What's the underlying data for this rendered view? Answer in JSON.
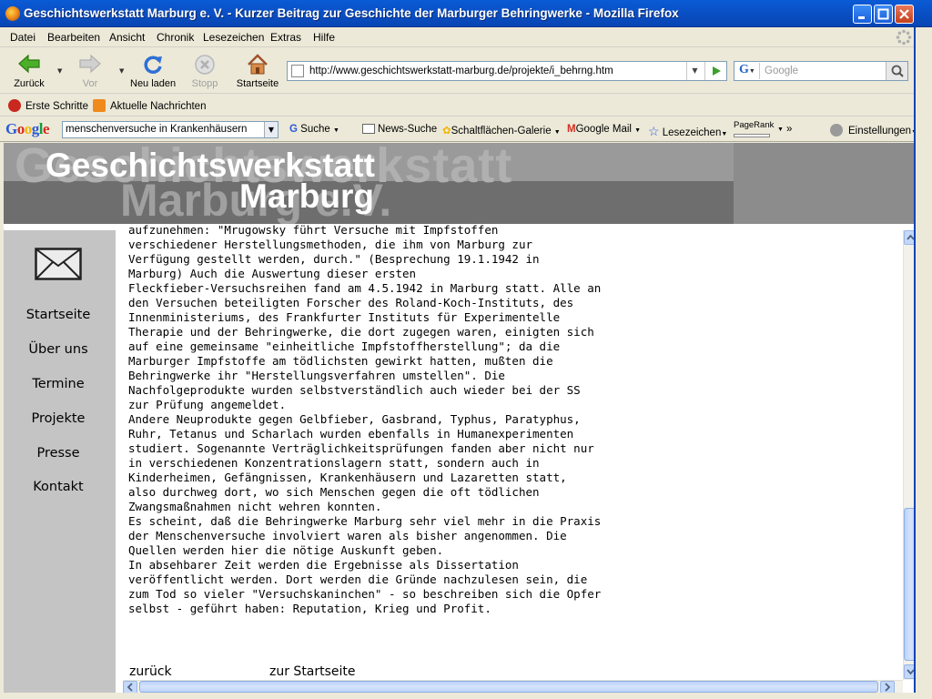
{
  "window": {
    "title": "Geschichtswerkstatt Marburg e. V. - Kurzer Beitrag zur Geschichte der Marburger Behringwerke - Mozilla Firefox"
  },
  "menu": [
    "Datei",
    "Bearbeiten",
    "Ansicht",
    "Chronik",
    "Lesezeichen",
    "Extras",
    "Hilfe"
  ],
  "nav": {
    "back": "Zurück",
    "forward": "Vor",
    "reload": "Neu laden",
    "stop": "Stopp",
    "home": "Startseite",
    "url": "http://www.geschichtswerkstatt-marburg.de/projekte/i_behrng.htm",
    "search_placeholder": "Google"
  },
  "bookmarks": [
    "Erste Schritte",
    "Aktuelle Nachrichten"
  ],
  "google_toolbar": {
    "logo": "Google",
    "query": "menschenversuche in Krankenhäusern",
    "search": "Suche",
    "news": "News-Suche",
    "gallery": "Schaltflächen-Galerie",
    "gmail": "Google Mail",
    "bookmarks": "Lesezeichen",
    "pagerank": "PageRank",
    "more": "»",
    "settings": "Einstellungen"
  },
  "banner": {
    "ghost_line1": "Geschichtswerkstatt",
    "ghost_line2": "Marburg e.V.",
    "title_line1": "Geschichtswerkstatt",
    "title_line2": "Marburg"
  },
  "sidebar": {
    "links": [
      "Startseite",
      "Über uns",
      "Termine",
      "Projekte",
      "Presse",
      "Kontakt"
    ]
  },
  "article": {
    "lines": [
      "aufzunehmen: \"Mrugowsky führt Versuche mit Impfstoffen",
      "verschiedener Herstellungsmethoden, die ihm von Marburg zur",
      "Verfügung gestellt werden, durch.\" (Besprechung 19.1.1942 in",
      "Marburg) Auch die Auswertung dieser ersten",
      "Fleckfieber-Versuchsreihen fand am 4.5.1942 in Marburg statt. Alle an",
      "den Versuchen beteiligten Forscher des Roland-Koch-Instituts, des",
      "Innenministeriums, des Frankfurter Instituts für Experimentelle",
      "Therapie und der Behringwerke, die dort zugegen waren, einigten sich",
      "auf eine gemeinsame \"einheitliche Impfstoffherstellung\"; da die",
      "Marburger Impfstoffe am tödlichsten gewirkt hatten, mußten die",
      "Behringwerke ihr \"Herstellungsverfahren umstellen\". Die",
      "Nachfolgeprodukte wurden selbstverständlich auch wieder bei der SS",
      "zur Prüfung angemeldet.",
      "Andere Neuprodukte gegen Gelbfieber, Gasbrand, Typhus, Paratyphus,",
      "Ruhr, Tetanus und Scharlach wurden ebenfalls in Humanexperimenten",
      "studiert. Sogenannte Verträglichkeitsprüfungen fanden aber nicht nur",
      "in verschiedenen Konzentrationslagern statt, sondern auch in",
      "Kinderheimen, Gefängnissen, Krankenhäusern und Lazaretten statt,",
      "also durchweg dort, wo sich Menschen gegen die oft tödlichen",
      "Zwangsmaßnahmen nicht wehren konnten.",
      "Es scheint, daß die Behringwerke Marburg sehr viel mehr in die Praxis",
      "der Menschenversuche involviert waren als bisher angenommen. Die",
      "Quellen werden hier die nötige Auskunft geben.",
      "In absehbarer Zeit werden die Ergebnisse als Dissertation",
      "veröffentlicht werden. Dort werden die Gründe nachzulesen sein, die",
      "zum Tod so vieler \"Versuchskaninchen\" - so beschreiben sich die Opfer",
      "selbst - geführt haben: Reputation, Krieg und Profit."
    ],
    "back_link": "zurück",
    "home_link": "zur Startseite"
  }
}
